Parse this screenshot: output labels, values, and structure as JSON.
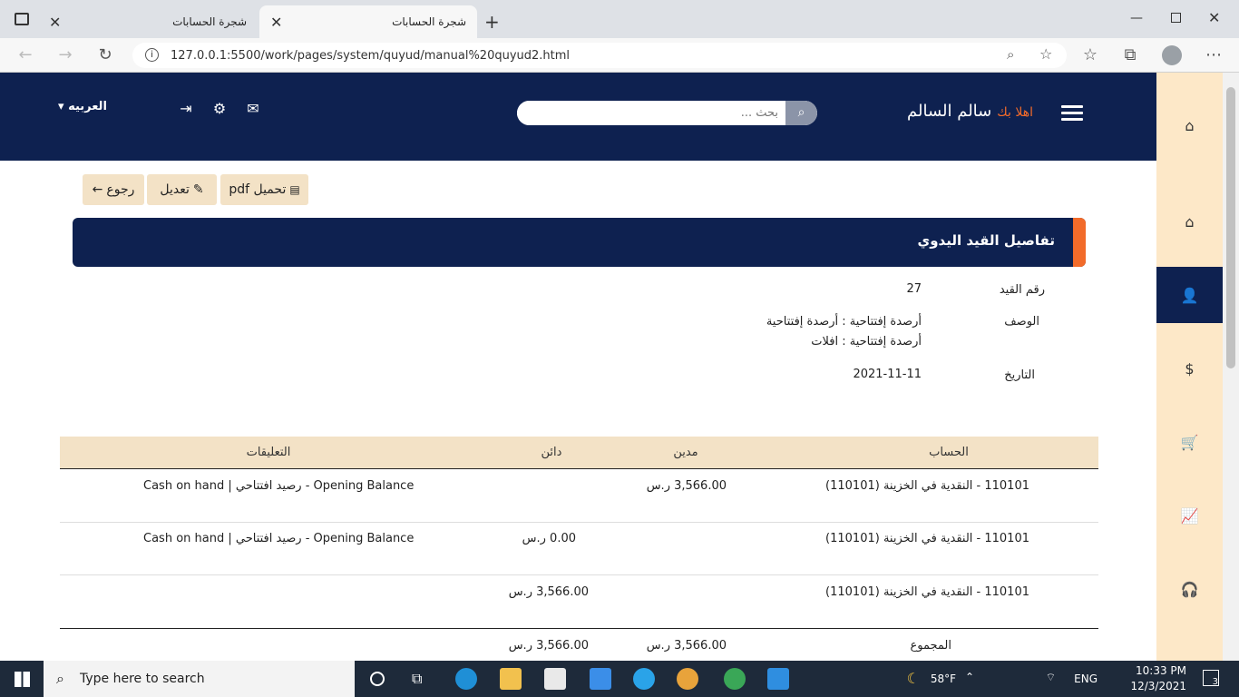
{
  "browser": {
    "tabs": [
      {
        "label": "شجرة الحسابات"
      },
      {
        "label": "شجرة الحسابات"
      }
    ],
    "url": "127.0.0.1:5500/work/pages/system/quyud/manual%20quyud2.html"
  },
  "header": {
    "greeting_prefix": "اهلا بك",
    "user_name": "سالم السالم",
    "search_placeholder": "بحث ...",
    "language": "العربيه"
  },
  "actions": {
    "download": "تحميل pdf",
    "edit": "تعديل",
    "back": "رجوع"
  },
  "panel": {
    "title": "تفاصيل القيد اليدوي"
  },
  "details": {
    "entry_number_label": "رقم القيد",
    "entry_number": "27",
    "description_label": "الوصف",
    "description_line1": "أرصدة إفتتاحية : أرصدة إفتتاحية",
    "description_line2": "أرصدة إفتتاحية : افلات",
    "date_label": "التاريخ",
    "date": "2021-11-11"
  },
  "table": {
    "headers": {
      "account": "الحساب",
      "debit": "مدين",
      "credit": "دائن",
      "comments": "التعليقات"
    },
    "rows": [
      {
        "account": "110101 - النقدية في الخزينة (110101)",
        "debit": "3,566.00 ر.س",
        "credit": "",
        "comment": "Cash on hand | رصيد افتتاحي - Opening Balance"
      },
      {
        "account": "110101 - النقدية في الخزينة (110101)",
        "debit": "",
        "credit": "0.00 ر.س",
        "comment": "Cash on hand | رصيد افتتاحي - Opening Balance"
      },
      {
        "account": "110101 - النقدية في الخزينة (110101)",
        "debit": "",
        "credit": "3,566.00 ر.س",
        "comment": ""
      }
    ],
    "total_label": "المجموع",
    "total_debit": "3,566.00 ر.س",
    "total_credit": "3,566.00 ر.س"
  },
  "taskbar": {
    "search_placeholder": "Type here to search",
    "temperature": "58°F",
    "language": "ENG",
    "time": "10:33 PM",
    "date": "12/3/2021",
    "notifications": "3"
  },
  "colors": {
    "navy": "#0e2150",
    "accent": "#f26b2a",
    "beige": "#f3e2c6",
    "sidebar": "#fde8c8"
  }
}
